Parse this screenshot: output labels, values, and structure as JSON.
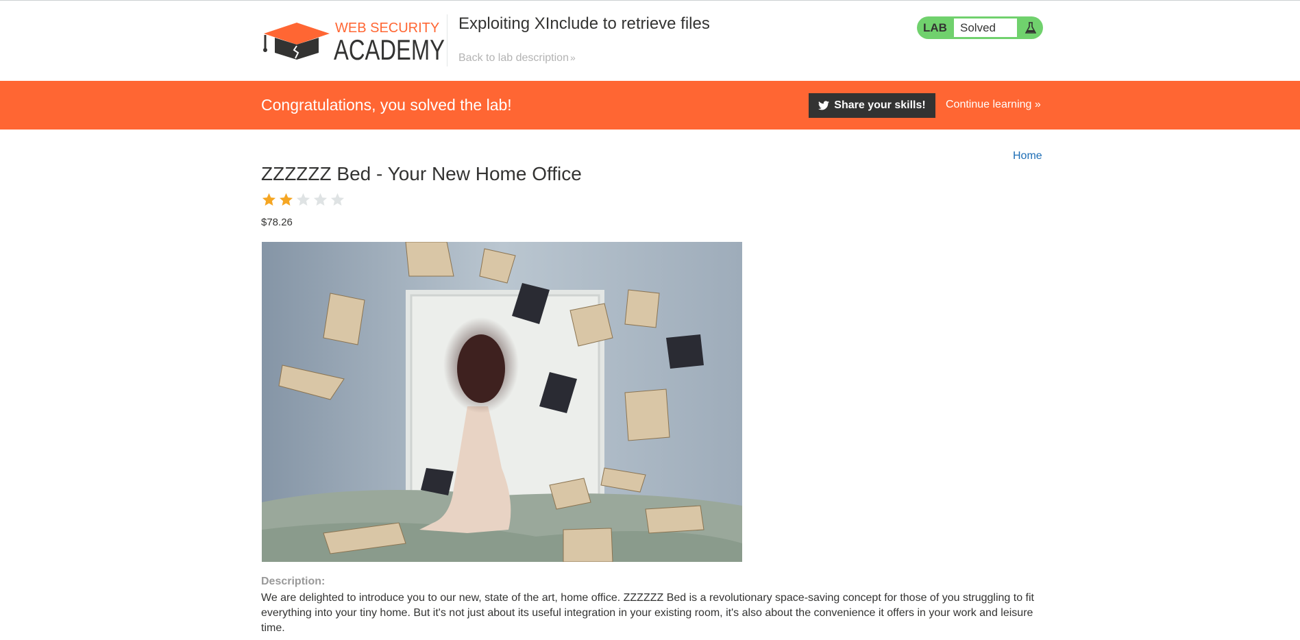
{
  "header": {
    "logo_line1": "WEB SECURITY",
    "logo_line2": "ACADEMY",
    "lab_title": "Exploiting XInclude to retrieve files",
    "back_link": "Back to lab description",
    "back_chevron": "»",
    "lab_badge": "LAB",
    "lab_status": "Solved"
  },
  "banner": {
    "message": "Congratulations, you solved the lab!",
    "share_label": "Share your skills!",
    "continue_label": "Continue learning",
    "continue_chevron": "»"
  },
  "nav": {
    "home": "Home"
  },
  "product": {
    "title": "ZZZZZZ Bed - Your New Home Office",
    "rating": 2,
    "rating_max": 5,
    "price": "$78.26",
    "description_label": "Description:",
    "description": "We are delighted to introduce you to our new, state of the art, home office. ZZZZZZ Bed is a revolutionary space-saving concept for those of you struggling to fit everything into your tiny home. But it's not just about its useful integration in your existing room, it's also about the convenience it offers in your work and leisure time."
  },
  "colors": {
    "accent": "#ff6633",
    "lab_green": "#70d16d",
    "link_blue": "#1c6db5",
    "star_filled": "#f5a623",
    "star_empty": "#dfe3e4"
  },
  "icons": {
    "logo": "graduation-cap-icon",
    "flask": "flask-icon",
    "twitter": "twitter-icon",
    "star": "star-icon"
  }
}
